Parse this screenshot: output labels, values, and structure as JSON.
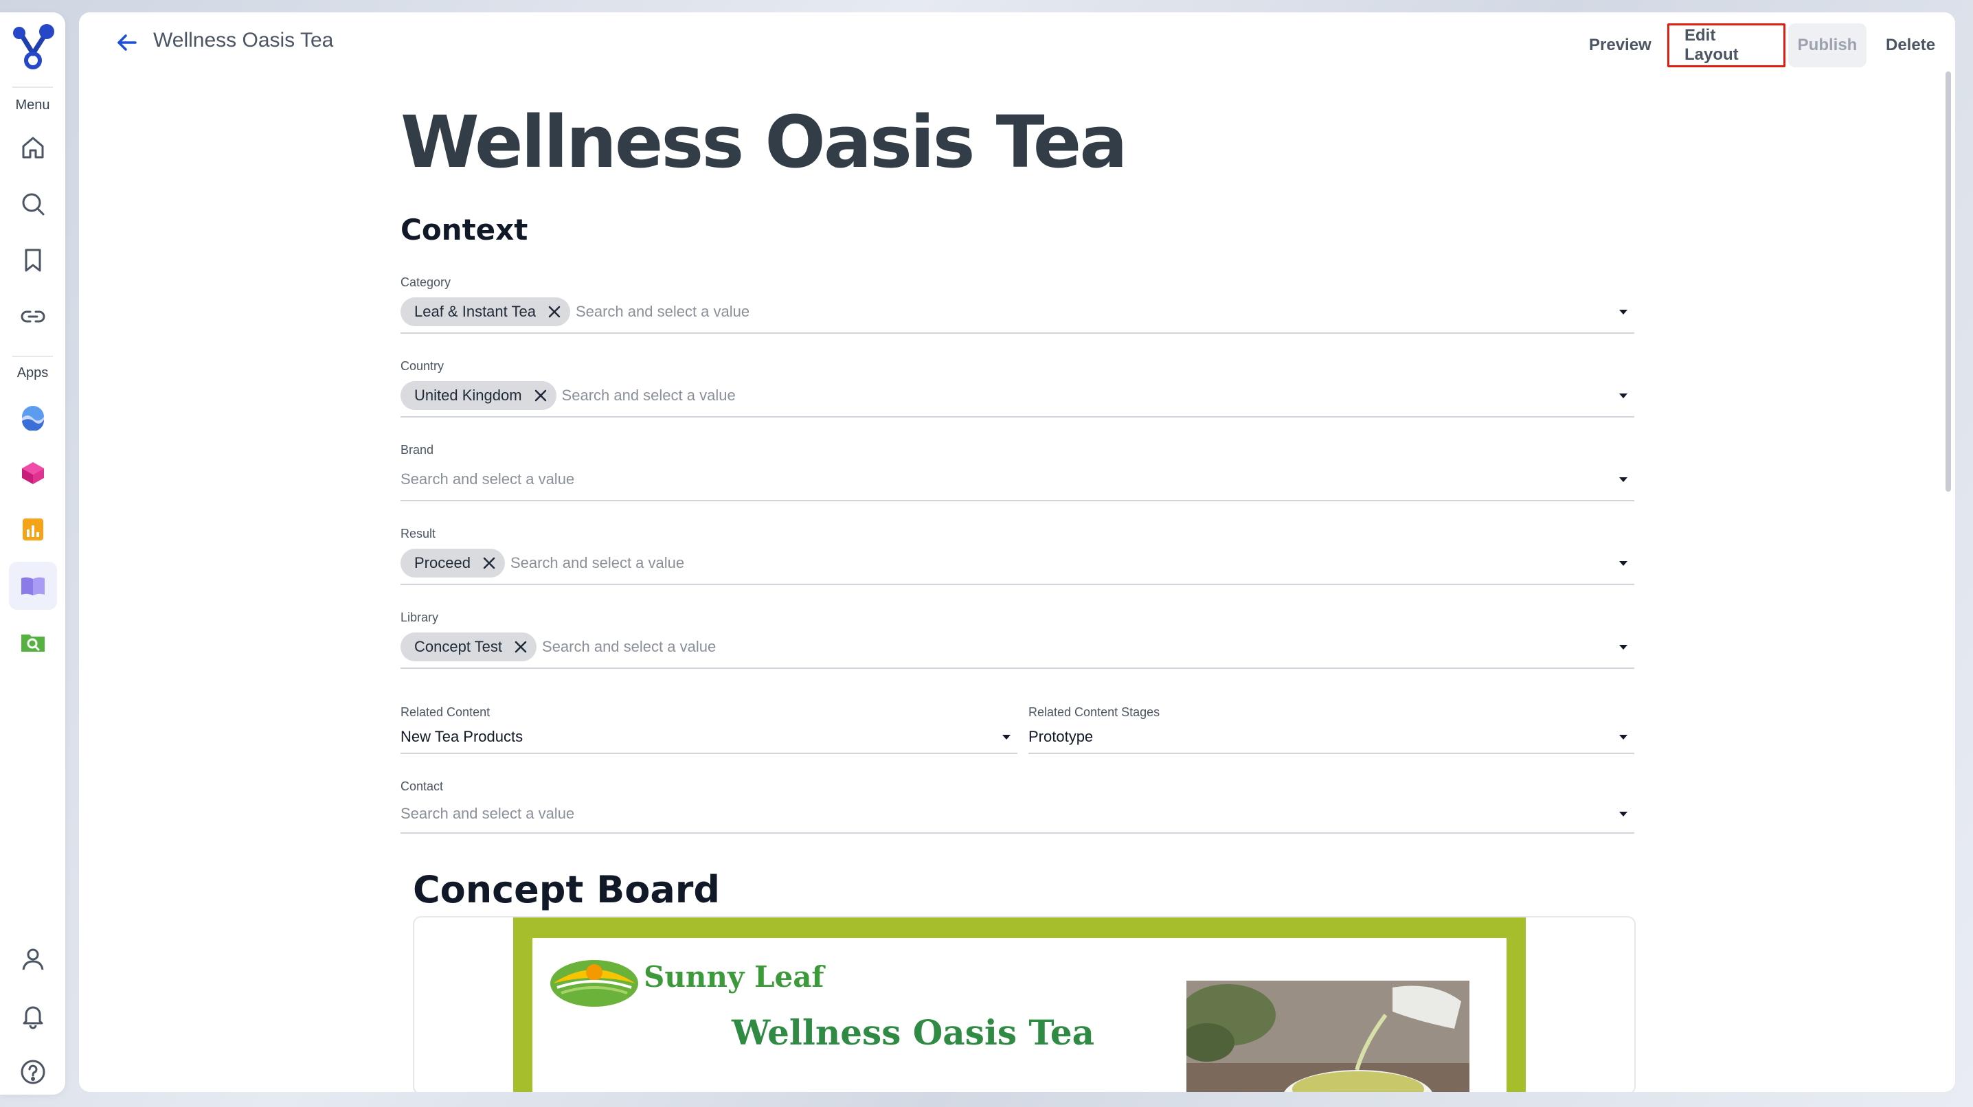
{
  "sidebar": {
    "menu_label": "Menu",
    "apps_label": "Apps",
    "menu_icons": [
      "home-icon",
      "search-icon",
      "bookmark-icon",
      "link-icon"
    ],
    "app_icons": [
      "app-wave-icon",
      "app-cube-icon",
      "app-chart-icon",
      "app-book-icon",
      "app-folder-search-icon"
    ],
    "bottom_icons": [
      "user-icon",
      "bell-icon",
      "help-icon"
    ]
  },
  "header": {
    "title": "Wellness Oasis Tea",
    "actions": {
      "preview": "Preview",
      "edit_layout": "Edit Layout",
      "publish": "Publish",
      "delete": "Delete"
    }
  },
  "page": {
    "title": "Wellness Oasis Tea",
    "section": "Context",
    "fields": {
      "category": {
        "label": "Category",
        "chip": "Leaf & Instant Tea",
        "placeholder": "Search and select a value"
      },
      "country": {
        "label": "Country",
        "chip": "United Kingdom",
        "placeholder": "Search and select a value"
      },
      "brand": {
        "label": "Brand",
        "placeholder": "Search and select a value"
      },
      "result": {
        "label": "Result",
        "chip": "Proceed",
        "placeholder": "Search and select a value"
      },
      "library": {
        "label": "Library",
        "chip": "Concept Test",
        "placeholder": "Search and select a value"
      },
      "related_content": {
        "label": "Related Content",
        "value": "New Tea Products"
      },
      "related_content_stages": {
        "label": "Related Content Stages",
        "value": "Prototype"
      },
      "contact": {
        "label": "Contact",
        "placeholder": "Search and select a value"
      }
    },
    "concept_board": {
      "title": "Concept Board",
      "brand_text": "Sunny Leaf",
      "product_text": "Wellness Oasis Tea",
      "frame_color": "#a6bd2c"
    }
  },
  "colors": {
    "accent": "#1d4ed8",
    "highlight_border": "#e11d0e"
  }
}
